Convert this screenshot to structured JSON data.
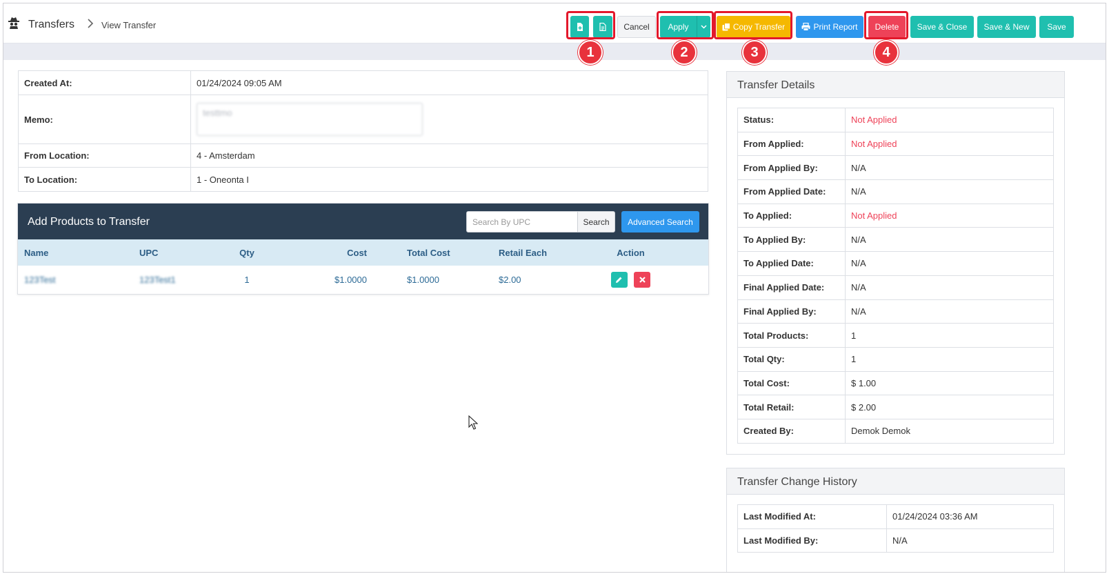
{
  "header": {
    "title": "Transfers",
    "breadcrumb": "View Transfer"
  },
  "toolbar": {
    "cancel": "Cancel",
    "apply": "Apply",
    "copy_transfer": "Copy Transfer",
    "print_report": "Print Report",
    "delete": "Delete",
    "save_close": "Save & Close",
    "save_new": "Save & New",
    "save": "Save"
  },
  "callouts": [
    "1",
    "2",
    "3",
    "4"
  ],
  "info": {
    "created_at_label": "Created At:",
    "created_at": "01/24/2024 09:05 AM",
    "memo_label": "Memo:",
    "memo": "testtmo",
    "from_label": "From Location:",
    "from": "4 - Amsterdam",
    "to_label": "To Location:",
    "to": "1 - Oneonta I"
  },
  "products": {
    "title": "Add Products to Transfer",
    "search_placeholder": "Search By UPC",
    "search_button": "Search",
    "advanced_button": "Advanced Search",
    "columns": [
      "Name",
      "UPC",
      "Qty",
      "Cost",
      "Total Cost",
      "Retail Each",
      "Action"
    ],
    "rows": [
      {
        "name": "123Test",
        "upc": "123Test1",
        "qty": "1",
        "cost": "$1.0000",
        "total_cost": "$1.0000",
        "retail_each": "$2.00"
      }
    ]
  },
  "details": {
    "title": "Transfer Details",
    "rows": [
      {
        "label": "Status:",
        "value": "Not Applied"
      },
      {
        "label": "From Applied:",
        "value": "Not Applied"
      },
      {
        "label": "From Applied By:",
        "value": "N/A"
      },
      {
        "label": "From Applied Date:",
        "value": "N/A"
      },
      {
        "label": "To Applied:",
        "value": "Not Applied"
      },
      {
        "label": "To Applied By:",
        "value": "N/A"
      },
      {
        "label": "To Applied Date:",
        "value": "N/A"
      },
      {
        "label": "Final Applied Date:",
        "value": "N/A"
      },
      {
        "label": "Final Applied By:",
        "value": "N/A"
      },
      {
        "label": "Total Products:",
        "value": "1"
      },
      {
        "label": "Total Qty:",
        "value": "1"
      },
      {
        "label": "Total Cost:",
        "value": "$ 1.00"
      },
      {
        "label": "Total Retail:",
        "value": "$ 2.00"
      },
      {
        "label": "Created By:",
        "value": "Demok Demok"
      }
    ]
  },
  "history": {
    "title": "Transfer Change History",
    "rows": [
      {
        "label": "Last Modified At:",
        "value": "01/24/2024 03:36 AM"
      },
      {
        "label": "Last Modified By:",
        "value": "N/A"
      }
    ]
  },
  "colors": {
    "teal": "#1fbfaf",
    "blue": "#2e97ee",
    "yellow": "#f5b800",
    "red": "#ee4258",
    "header_dark": "#2b3e52",
    "callout": "#e8323c"
  },
  "icons": [
    "spy-icon",
    "chevron-right-icon",
    "new-file-icon",
    "document-icon",
    "chevron-down-icon",
    "copy-icon",
    "print-icon",
    "pencil-icon",
    "close-icon",
    "mouse-cursor-icon"
  ]
}
